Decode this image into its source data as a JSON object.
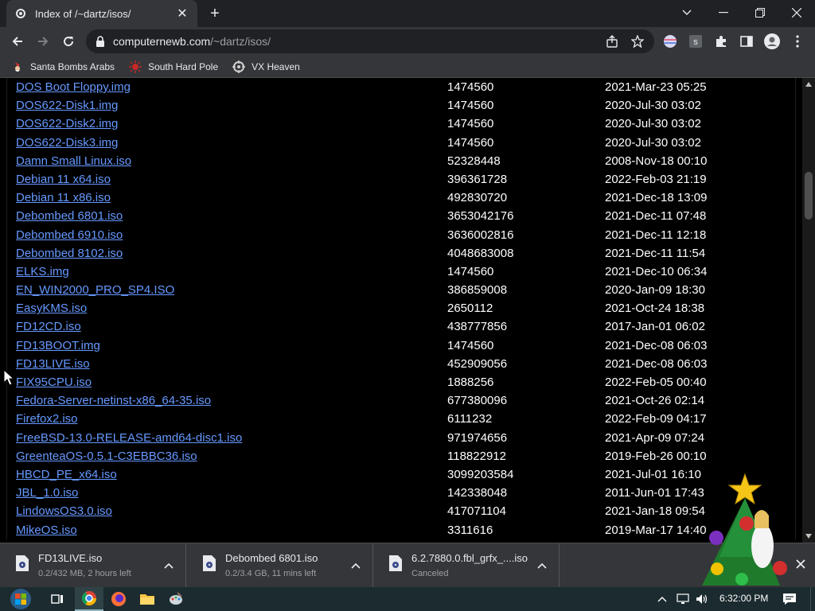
{
  "tab": {
    "title": "Index of /~dartz/isos/"
  },
  "omnibox": {
    "url_host": "computernewb.com",
    "url_path": "/~dartz/isos/"
  },
  "bookmarks": [
    {
      "label": "Santa Bombs Arabs"
    },
    {
      "label": "South Hard Pole"
    },
    {
      "label": "VX Heaven"
    }
  ],
  "listing": [
    {
      "name": "DOS Boot Floppy.img",
      "size": "1474560",
      "date": "2021-Mar-23 05:25"
    },
    {
      "name": "DOS622-Disk1.img",
      "size": "1474560",
      "date": "2020-Jul-30 03:02"
    },
    {
      "name": "DOS622-Disk2.img",
      "size": "1474560",
      "date": "2020-Jul-30 03:02"
    },
    {
      "name": "DOS622-Disk3.img",
      "size": "1474560",
      "date": "2020-Jul-30 03:02"
    },
    {
      "name": "Damn Small Linux.iso",
      "size": "52328448",
      "date": "2008-Nov-18 00:10"
    },
    {
      "name": "Debian 11 x64.iso",
      "size": "396361728",
      "date": "2022-Feb-03 21:19"
    },
    {
      "name": "Debian 11 x86.iso",
      "size": "492830720",
      "date": "2021-Dec-18 13:09"
    },
    {
      "name": "Debombed 6801.iso",
      "size": "3653042176",
      "date": "2021-Dec-11 07:48"
    },
    {
      "name": "Debombed 6910.iso",
      "size": "3636002816",
      "date": "2021-Dec-11 12:18"
    },
    {
      "name": "Debombed 8102.iso",
      "size": "4048683008",
      "date": "2021-Dec-11 11:54"
    },
    {
      "name": "ELKS.img",
      "size": "1474560",
      "date": "2021-Dec-10 06:34"
    },
    {
      "name": "EN_WIN2000_PRO_SP4.ISO",
      "size": "386859008",
      "date": "2020-Jan-09 18:30"
    },
    {
      "name": "EasyKMS.iso",
      "size": "2650112",
      "date": "2021-Oct-24 18:38"
    },
    {
      "name": "FD12CD.iso",
      "size": "438777856",
      "date": "2017-Jan-01 06:02"
    },
    {
      "name": "FD13BOOT.img",
      "size": "1474560",
      "date": "2021-Dec-08 06:03"
    },
    {
      "name": "FD13LIVE.iso",
      "size": "452909056",
      "date": "2021-Dec-08 06:03"
    },
    {
      "name": "FIX95CPU.iso",
      "size": "1888256",
      "date": "2022-Feb-05 00:40"
    },
    {
      "name": "Fedora-Server-netinst-x86_64-35.iso",
      "size": "677380096",
      "date": "2021-Oct-26 02:14"
    },
    {
      "name": "Firefox2.iso",
      "size": "6111232",
      "date": "2022-Feb-09 04:17"
    },
    {
      "name": "FreeBSD-13.0-RELEASE-amd64-disc1.iso",
      "size": "971974656",
      "date": "2021-Apr-09 07:24"
    },
    {
      "name": "GreenteaOS-0.5.1-C3EBBC36.iso",
      "size": "118822912",
      "date": "2019-Feb-26 00:10"
    },
    {
      "name": "HBCD_PE_x64.iso",
      "size": "3099203584",
      "date": "2021-Jul-01 16:10"
    },
    {
      "name": "JBL_1.0.iso",
      "size": "142338048",
      "date": "2011-Jun-01 17:43"
    },
    {
      "name": "LindowsOS3.0.iso",
      "size": "417071104",
      "date": "2021-Jan-18 09:54"
    },
    {
      "name": "MikeOS.iso",
      "size": "3311616",
      "date": "2019-Mar-17 14:40"
    }
  ],
  "downloads": [
    {
      "name": "FD13LIVE.iso",
      "status": "0.2/432 MB, 2 hours left"
    },
    {
      "name": "Debombed 6801.iso",
      "status": "0.2/3.4 GB, 11 mins left"
    },
    {
      "name": "6.2.7880.0.fbl_grfx_....iso",
      "status": "Canceled"
    }
  ],
  "taskbar": {
    "clock": "6:32:00 PM"
  },
  "colors": {
    "link": "#6699ff",
    "page_bg": "#000000",
    "chrome_bg": "#35363a",
    "taskbar_bg": "#1c2b2f"
  },
  "icons": {
    "tab_favicon": "gear-icon",
    "back": "arrow-left-icon",
    "forward": "arrow-right-icon",
    "reload": "reload-icon",
    "lock": "lock-icon",
    "share": "share-icon",
    "bookmark_star": "star-icon",
    "extensions": "puzzle-icon",
    "sidepanel": "side-panel-icon",
    "profile": "profile-icon",
    "menu": "kebab-menu-icon",
    "download_file": "disc-image-icon",
    "start": "windows-logo-icon",
    "notifications": "notification-icon"
  }
}
